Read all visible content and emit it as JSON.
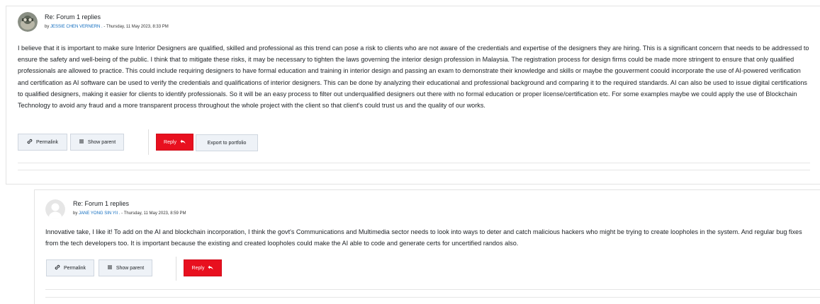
{
  "posts": [
    {
      "subject": "Re: Forum 1 replies",
      "by_prefix": "by",
      "author": "JESSIE CHEN VERNERN .",
      "date_sep": " - ",
      "date": "Thursday, 11 May 2023, 8:33 PM",
      "content": "I believe that it is important to make sure Interior Designers are qualified, skilled and professional as this trend can pose a risk to clients who are not aware of the credentials and expertise of the designers they are hiring. This is a significant concern that needs to be addressed to ensure the safety and well-being of the public. I think that to mitigate these risks, it may be necessary to tighten the laws governing the interior design profession in Malaysia. The registration process for design firms could be made more stringent to ensure that only qualified professionals are allowed to practice. This could include requiring designers to have formal education and training in interior design and passing an exam to demonstrate their knowledge and skills or maybe the gouverment coould incorporate the use of AI-powered verification and certification as AI software can be used to verify the credentials and qualifications of interior designers. This can be done by analyzing their educational and professional background and comparing it to the required standards. AI can also be used to issue digital certifications to qualified designers, making it easier for clients to identify professionals. So it will be an easy process to filter out underqualified designers out there with no formal education or proper license/certification etc. For some examples maybe we could apply the use of Blockchain Technology to avoid any fraud and a more transparent process throughout the whole project with the client so that client's could trust us and the quality of our works.",
      "actions": {
        "permalink": "Permalink",
        "show_parent": "Show parent",
        "reply": "Reply",
        "export": "Export to portfolio"
      }
    },
    {
      "subject": "Re: Forum 1 replies",
      "by_prefix": "by",
      "author": "JANE YONG SIN YII .",
      "date_sep": " - ",
      "date": "Thursday, 11 May 2023, 8:59 PM",
      "content": "Innovative take, I like it! To add on the AI and blockchain incorporation, I think the govt's Communications and Multimedia sector needs to look into ways to deter and catch malicious hackers who might be trying to create loopholes in the system. And regular bug fixes from the tech developers too. It is important because the existing and created loopholes could make the AI able to code and generate certs for uncertified randos also.",
      "actions": {
        "permalink": "Permalink",
        "show_parent": "Show parent",
        "reply": "Reply"
      }
    }
  ],
  "icons": {
    "permalink": "link-icon",
    "show_parent": "list-icon",
    "reply": "reply-icon",
    "avatar_default": "user-silhouette-icon"
  },
  "colors": {
    "reply_button": "#e8101f",
    "author_link": "#0f6cbf",
    "secondary_button": "#eef2f7"
  }
}
